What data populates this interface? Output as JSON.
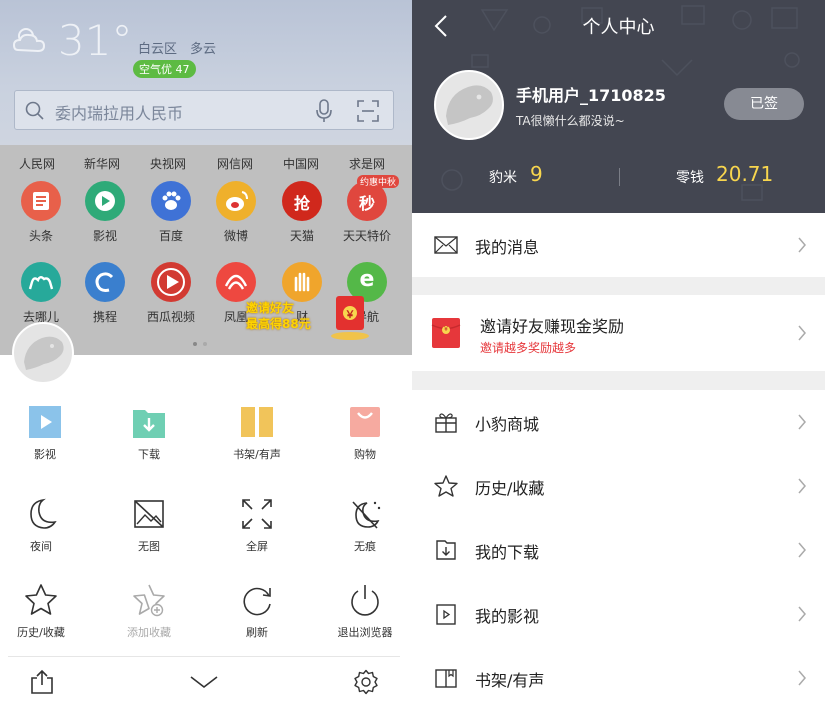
{
  "left": {
    "weather": {
      "temperature": "31°",
      "district": "白云区",
      "condition": "多云",
      "aqi": "空气优 47"
    },
    "search": {
      "placeholder": "委内瑞拉用人民币"
    },
    "site_links": [
      "人民网",
      "新华网",
      "央视网",
      "网信网",
      "中国网",
      "求是网"
    ],
    "apps_row1": [
      {
        "label": "头条",
        "color": "#e8604a"
      },
      {
        "label": "影视",
        "color": "#2eaa78"
      },
      {
        "label": "百度",
        "color": "#3f72d6"
      },
      {
        "label": "微博",
        "color": "#efb02b"
      },
      {
        "label": "天猫",
        "color": "#d0281c"
      },
      {
        "label": "天天特价",
        "color": "#e0473e"
      }
    ],
    "apps_row1_badge": "约惠中秋",
    "apps_row2": [
      {
        "label": "去哪儿",
        "color": "#27a99a"
      },
      {
        "label": "携程",
        "color": "#3a7fce"
      },
      {
        "label": "西瓜视频",
        "color": "#d23a32"
      },
      {
        "label": "凤凰",
        "color": "#ee4840"
      },
      {
        "label": "财",
        "color": "#f0a52c"
      },
      {
        "label": "导航",
        "color": "#54b848"
      }
    ],
    "apps_row1_glyphs": {
      "tmall": "抢",
      "tejia": "秒"
    },
    "promo": {
      "line1": "邀请好友",
      "line2": "最高得88元",
      "envelope_char": "￥"
    },
    "menu": [
      {
        "label": "影视",
        "icon": "play-tile-icon"
      },
      {
        "label": "下载",
        "icon": "download-folder-icon"
      },
      {
        "label": "书架/有声",
        "icon": "bookshelf-icon"
      },
      {
        "label": "购物",
        "icon": "shopping-bag-icon"
      },
      {
        "label": "夜间",
        "icon": "moon-icon"
      },
      {
        "label": "无图",
        "icon": "no-image-icon"
      },
      {
        "label": "全屏",
        "icon": "fullscreen-icon"
      },
      {
        "label": "无痕",
        "icon": "incognito-icon"
      },
      {
        "label": "历史/收藏",
        "icon": "star-icon"
      },
      {
        "label": "添加收藏",
        "icon": "add-favorite-icon"
      },
      {
        "label": "刷新",
        "icon": "refresh-icon"
      },
      {
        "label": "退出浏览器",
        "icon": "power-icon"
      }
    ]
  },
  "right": {
    "title": "个人中心",
    "profile": {
      "username": "手机用户_1710825",
      "signature": "TA很懒什么都没说~",
      "checkin_label": "已签"
    },
    "stats": {
      "coins_label": "豹米",
      "coins_value": "9",
      "change_label": "零钱",
      "change_value": "20.71"
    },
    "messages": {
      "label": "我的消息"
    },
    "invite": {
      "title": "邀请好友赚现金奖励",
      "subtitle": "邀请越多奖励越多",
      "icon_char": "￥"
    },
    "items": [
      {
        "label": "小豹商城",
        "icon": "gift-icon"
      },
      {
        "label": "历史/收藏",
        "icon": "star-icon"
      },
      {
        "label": "我的下载",
        "icon": "download-icon"
      },
      {
        "label": "我的影视",
        "icon": "video-icon"
      },
      {
        "label": "书架/有声",
        "icon": "book-icon"
      }
    ]
  },
  "colors": {
    "header_bg": "#434651",
    "accent_yellow": "#f8d64e",
    "invite_red": "#e6373b",
    "aqi_green": "#5dbb43"
  }
}
